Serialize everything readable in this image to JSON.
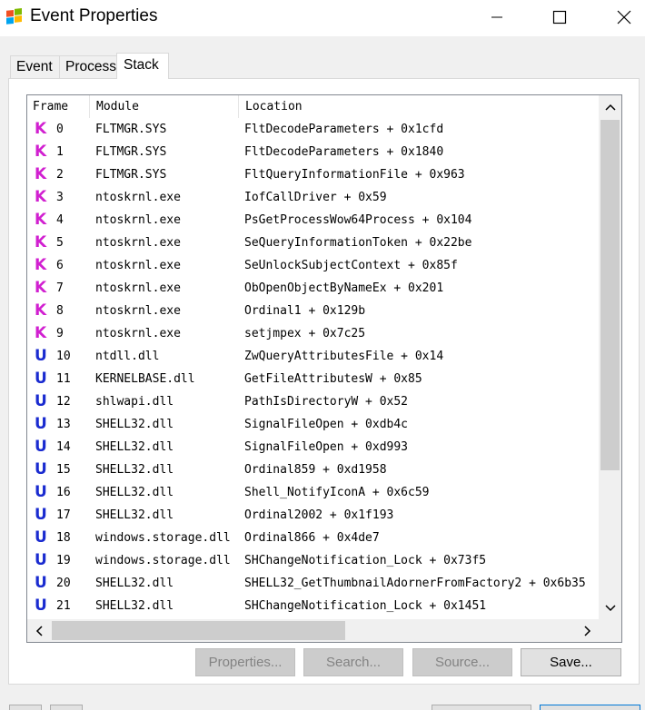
{
  "window": {
    "title": "Event Properties",
    "icon": "event-properties-app-icon"
  },
  "tabs": [
    {
      "label": "Event",
      "active": false
    },
    {
      "label": "Process",
      "active": false
    },
    {
      "label": "Stack",
      "active": true
    }
  ],
  "columns": {
    "frame": "Frame",
    "module": "Module",
    "location": "Location"
  },
  "rows": [
    {
      "type": "K",
      "frame": "0",
      "module": "FLTMGR.SYS",
      "location": "FltDecodeParameters + 0x1cfd"
    },
    {
      "type": "K",
      "frame": "1",
      "module": "FLTMGR.SYS",
      "location": "FltDecodeParameters + 0x1840"
    },
    {
      "type": "K",
      "frame": "2",
      "module": "FLTMGR.SYS",
      "location": "FltQueryInformationFile + 0x963"
    },
    {
      "type": "K",
      "frame": "3",
      "module": "ntoskrnl.exe",
      "location": "IofCallDriver + 0x59"
    },
    {
      "type": "K",
      "frame": "4",
      "module": "ntoskrnl.exe",
      "location": "PsGetProcessWow64Process + 0x104"
    },
    {
      "type": "K",
      "frame": "5",
      "module": "ntoskrnl.exe",
      "location": "SeQueryInformationToken + 0x22be"
    },
    {
      "type": "K",
      "frame": "6",
      "module": "ntoskrnl.exe",
      "location": "SeUnlockSubjectContext + 0x85f"
    },
    {
      "type": "K",
      "frame": "7",
      "module": "ntoskrnl.exe",
      "location": "ObOpenObjectByNameEx + 0x201"
    },
    {
      "type": "K",
      "frame": "8",
      "module": "ntoskrnl.exe",
      "location": "Ordinal1 + 0x129b"
    },
    {
      "type": "K",
      "frame": "9",
      "module": "ntoskrnl.exe",
      "location": "setjmpex + 0x7c25"
    },
    {
      "type": "U",
      "frame": "10",
      "module": "ntdll.dll",
      "location": "ZwQueryAttributesFile + 0x14"
    },
    {
      "type": "U",
      "frame": "11",
      "module": "KERNELBASE.dll",
      "location": "GetFileAttributesW + 0x85"
    },
    {
      "type": "U",
      "frame": "12",
      "module": "shlwapi.dll",
      "location": "PathIsDirectoryW + 0x52"
    },
    {
      "type": "U",
      "frame": "13",
      "module": "SHELL32.dll",
      "location": "SignalFileOpen + 0xdb4c"
    },
    {
      "type": "U",
      "frame": "14",
      "module": "SHELL32.dll",
      "location": "SignalFileOpen + 0xd993"
    },
    {
      "type": "U",
      "frame": "15",
      "module": "SHELL32.dll",
      "location": "Ordinal859 + 0xd1958"
    },
    {
      "type": "U",
      "frame": "16",
      "module": "SHELL32.dll",
      "location": "Shell_NotifyIconA + 0x6c59"
    },
    {
      "type": "U",
      "frame": "17",
      "module": "SHELL32.dll",
      "location": "Ordinal2002 + 0x1f193"
    },
    {
      "type": "U",
      "frame": "18",
      "module": "windows.storage.dll",
      "location": "Ordinal866 + 0x4de7"
    },
    {
      "type": "U",
      "frame": "19",
      "module": "windows.storage.dll",
      "location": "SHChangeNotification_Lock + 0x73f5"
    },
    {
      "type": "U",
      "frame": "20",
      "module": "SHELL32.dll",
      "location": "SHELL32_GetThumbnailAdornerFromFactory2 + 0x6b35"
    },
    {
      "type": "U",
      "frame": "21",
      "module": "SHELL32.dll",
      "location": "SHChangeNotification_Lock + 0x1451"
    }
  ],
  "buttons": {
    "properties": "Properties...",
    "search": "Search...",
    "source": "Source...",
    "save": "Save..."
  },
  "colors": {
    "kernel_frame": "#d11fd0",
    "user_frame": "#1a2bd0"
  }
}
